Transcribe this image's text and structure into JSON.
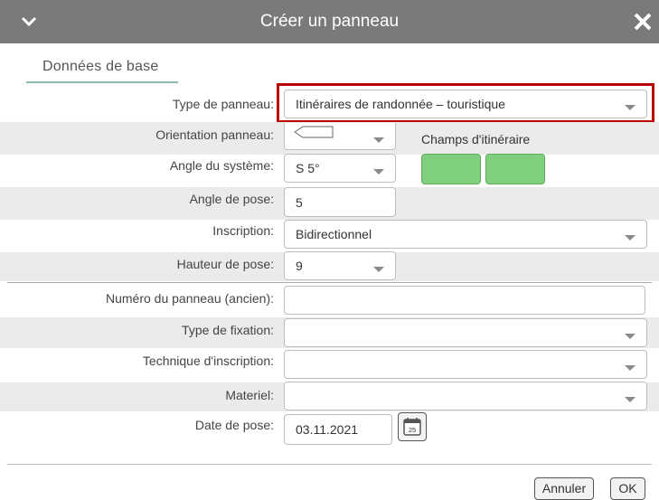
{
  "dialog": {
    "title": "Créer un panneau",
    "collapse_icon": "chevron-down-icon",
    "close_icon": "close-icon"
  },
  "tab": {
    "label": "Données de base"
  },
  "fields": {
    "type_panneau": {
      "label": "Type de panneau:",
      "value": "Itinéraires de randonnée – touristique"
    },
    "orientation": {
      "label": "Orientation panneau:"
    },
    "angle_systeme": {
      "label": "Angle du système:",
      "value": "S 5°"
    },
    "angle_pose": {
      "label": "Angle de pose:",
      "value": "5"
    },
    "inscription": {
      "label": "Inscription:",
      "value": "Bidirectionnel"
    },
    "hauteur_pose": {
      "label": "Hauteur de pose:",
      "value": "9"
    },
    "numero_ancien": {
      "label": "Numéro du panneau (ancien):",
      "value": ""
    },
    "type_fixation": {
      "label": "Type de fixation:",
      "value": ""
    },
    "technique_inscription": {
      "label": "Technique d'inscription:",
      "value": ""
    },
    "materiel": {
      "label": "Materiel:",
      "value": ""
    },
    "date_pose": {
      "label": "Date de pose:",
      "value": "03.11.2021",
      "calendar_day": "25"
    }
  },
  "champs_itineraire": {
    "label": "Champs d'itinéraire",
    "color": "#7fcf7f"
  },
  "buttons": {
    "cancel": "Annuler",
    "ok": "OK"
  },
  "colors": {
    "titlebar": "#7a7a7a",
    "highlight": "#bb0000",
    "stripe": "#ebebeb"
  }
}
